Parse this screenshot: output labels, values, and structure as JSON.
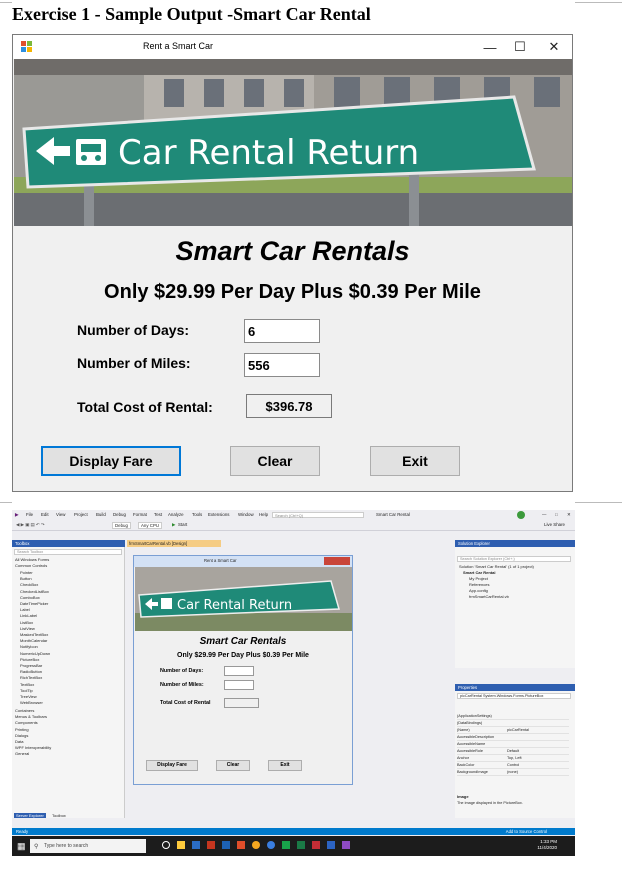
{
  "document": {
    "heading": "Exercise 1 - Sample Output -Smart Car Rental"
  },
  "app": {
    "window_title": "Rent a Smart Car",
    "banner": {
      "sign_text": "Car Rental Return",
      "icons": [
        "left-arrow-icon",
        "car-icon"
      ]
    },
    "title": "Smart Car Rentals",
    "subtitle": "Only $29.99 Per Day Plus $0.39 Per Mile",
    "fields": {
      "days_label": "Number of Days:",
      "days_value": "6",
      "miles_label": "Number of Miles:",
      "miles_value": "556",
      "total_label": "Total Cost of Rental:",
      "total_value": "$396.78"
    },
    "buttons": {
      "display_fare": "Display Fare",
      "clear": "Clear",
      "exit": "Exit"
    },
    "window_controls": [
      "minimize-icon",
      "maximize-icon",
      "close-icon"
    ]
  },
  "ide": {
    "menus": [
      "File",
      "Edit",
      "View",
      "Project",
      "Build",
      "Debug",
      "Format",
      "Test",
      "Analyze",
      "Tools",
      "Extensions",
      "Window",
      "Help"
    ],
    "search_placeholder": "Search (Ctrl+Q)",
    "solution_name_title": "Smart Car Rental",
    "toolbar": {
      "config": "Debug",
      "platform": "Any CPU",
      "start": "Start"
    },
    "live_share": "Live Share",
    "toolbox": {
      "title": "Toolbox",
      "search_placeholder": "Search Toolbox",
      "groups": [
        "All Windows Forms",
        "Common Controls"
      ],
      "items": [
        "Pointer",
        "Button",
        "CheckBox",
        "CheckedListBox",
        "ComboBox",
        "DateTimePicker",
        "Label",
        "LinkLabel",
        "ListBox",
        "ListView",
        "MaskedTextBox",
        "MonthCalendar",
        "NotifyIcon",
        "NumericUpDown",
        "PictureBox",
        "ProgressBar",
        "RadioButton",
        "RichTextBox",
        "TextBox",
        "ToolTip",
        "TreeView",
        "WebBrowser"
      ],
      "more_groups": [
        "Containers",
        "Menus & Toolbars",
        "Components",
        "Printing",
        "Dialogs",
        "Data",
        "WPF Interoperability",
        "General"
      ],
      "bottom_tabs": [
        "Server Explorer",
        "Toolbox"
      ]
    },
    "designer": {
      "tab_label": "frmSmartCarRental.vb [Design]",
      "form_title": "Rent a Smart Car",
      "sign_text": "Car Rental Return",
      "title": "Smart Car Rentals",
      "subtitle": "Only $29.99 Per Day Plus $0.39 Per Mile",
      "days_label": "Number of Days:",
      "miles_label": "Number of Miles:",
      "total_label": "Total Cost of Rental",
      "buttons": [
        "Display Fare",
        "Clear",
        "Exit"
      ]
    },
    "solution_explorer": {
      "title": "Solution Explorer",
      "search_placeholder": "Search Solution Explorer (Ctrl+;)",
      "items": [
        "Solution 'Smart Car Rental' (1 of 1 project)",
        "Smart Car Rental",
        "My Project",
        "References",
        "App.config",
        "frmSmartCarRental.vb"
      ]
    },
    "properties": {
      "title": "Properties",
      "object": "picCarRental System.Windows.Forms.PictureBox",
      "rows": [
        {
          "name": "(ApplicationSettings)",
          "value": ""
        },
        {
          "name": "(DataBindings)",
          "value": ""
        },
        {
          "name": "(Name)",
          "value": "picCarRental"
        },
        {
          "name": "AccessibleDescription",
          "value": ""
        },
        {
          "name": "AccessibleName",
          "value": ""
        },
        {
          "name": "AccessibleRole",
          "value": "Default"
        },
        {
          "name": "Anchor",
          "value": "Top, Left"
        },
        {
          "name": "BackColor",
          "value": "Control"
        },
        {
          "name": "BackgroundImage",
          "value": "(none)"
        }
      ],
      "desc_title": "Image",
      "desc_text": "The image displayed in the PictureBox."
    },
    "status": {
      "ready": "Ready",
      "source_control": "Add to Source Control"
    }
  },
  "taskbar": {
    "search_placeholder": "Type here to search",
    "time": "1:33 PM",
    "date": "11/4/2020"
  },
  "colors": {
    "sign_green": "#1f8a78",
    "vs_blue": "#007acc",
    "accent_border": "#0078d7"
  }
}
